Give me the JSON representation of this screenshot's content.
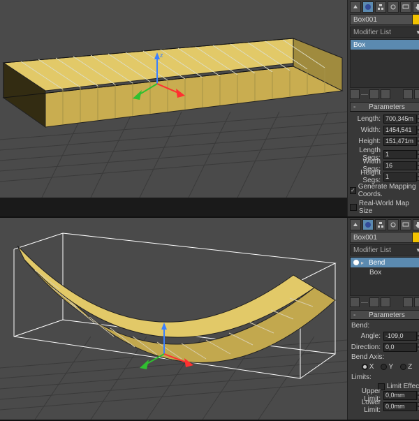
{
  "top": {
    "object_name": "Box001",
    "swatch_color": "#f2c200",
    "modifier_dropdown": "Modifier List",
    "stack": [
      {
        "label": "Box",
        "selected": true
      }
    ],
    "params_header": "Parameters",
    "length": {
      "label": "Length:",
      "value": "700,345m"
    },
    "width": {
      "label": "Width:",
      "value": "1454,541"
    },
    "height": {
      "label": "Height:",
      "value": "151,471m"
    },
    "lsegs": {
      "label": "Length Segs:",
      "value": "1"
    },
    "wsegs": {
      "label": "Width Segs:",
      "value": "16"
    },
    "hsegs": {
      "label": "Height Segs:",
      "value": "1"
    },
    "gen_map": {
      "label": "Generate Mapping Coords.",
      "checked": true
    },
    "rw_map": {
      "label": "Real-World Map Size",
      "checked": false
    }
  },
  "bottom": {
    "object_name": "Box001",
    "swatch_color": "#f2c200",
    "modifier_dropdown": "Modifier List",
    "stack": [
      {
        "label": "Bend",
        "selected": true,
        "bulb": true
      },
      {
        "label": "Box",
        "selected": false
      }
    ],
    "params_header": "Parameters",
    "bend_group": "Bend:",
    "angle": {
      "label": "Angle:",
      "value": "-109,0"
    },
    "dir": {
      "label": "Direction:",
      "value": "0,0"
    },
    "axis_group": "Bend Axis:",
    "axis_x": "X",
    "axis_y": "Y",
    "axis_z": "Z",
    "axis_sel": "X",
    "limits_group": "Limits:",
    "limit_effect": {
      "label": "Limit Effect",
      "checked": false
    },
    "upper": {
      "label": "Upper Limit:",
      "value": "0,0mm"
    },
    "lower": {
      "label": "Lower Limit:",
      "value": "0,0mm"
    }
  }
}
